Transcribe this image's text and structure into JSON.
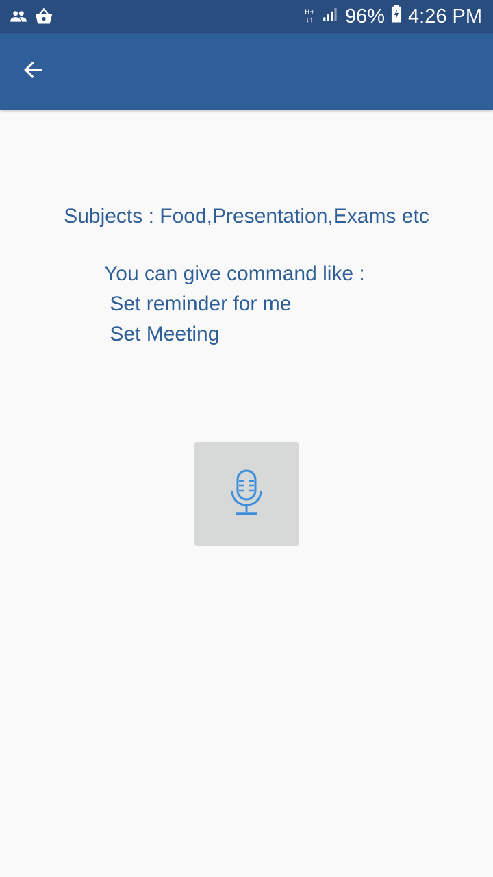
{
  "status_bar": {
    "left_icons": [
      "people-icon",
      "shopping-basket-icon"
    ],
    "network_type_top": "H+",
    "network_type_bottom": "↓↑",
    "battery_percent": "96%",
    "time": "4:26 PM"
  },
  "app_bar": {
    "back_icon": "arrow-left-icon"
  },
  "content": {
    "subjects": "Subjects : Food,Presentation,Exams etc",
    "command_intro": "You can give command like :",
    "commands": [
      " Set reminder for me",
      " Set Meeting"
    ]
  },
  "mic": {
    "icon": "microphone-icon"
  },
  "colors": {
    "status_bar": "#2a4d80",
    "app_bar": "#2f5f98",
    "text": "#2f5f98",
    "mic_background": "#d7d8d8",
    "mic_icon": "#3d8fdc",
    "page_background": "#f9f9f9"
  }
}
